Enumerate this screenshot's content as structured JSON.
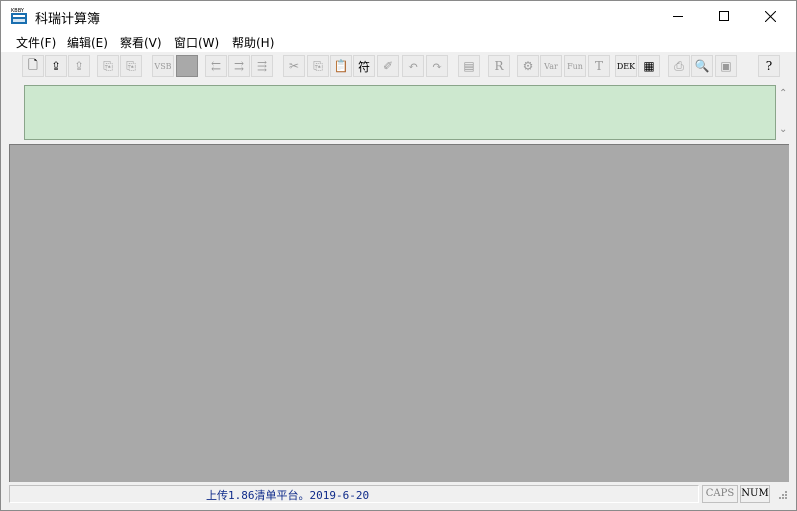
{
  "window": {
    "title": "科瑞计算簿",
    "icon_text": "KBBY"
  },
  "menu": [
    {
      "label": "文件(F)"
    },
    {
      "label": "编辑(E)"
    },
    {
      "label": "察看(V)"
    },
    {
      "label": "窗口(W)"
    },
    {
      "label": "帮助(H)"
    }
  ],
  "toolbar": {
    "buttons": [
      {
        "icon": "new-document-icon",
        "glyph": "🗋",
        "enabled": true
      },
      {
        "icon": "open-icon",
        "glyph": "⇪",
        "enabled": true
      },
      {
        "icon": "save-icon",
        "glyph": "⇪",
        "enabled": false
      },
      {
        "icon": "copy-page-icon",
        "glyph": "⎘",
        "enabled": false
      },
      {
        "icon": "paste-page-icon",
        "glyph": "⎘",
        "enabled": false
      },
      {
        "icon": "vsb-icon",
        "glyph": "VSB",
        "enabled": false
      },
      {
        "icon": "blank-icon",
        "glyph": "",
        "enabled": false
      },
      {
        "icon": "arrow-left-icon",
        "glyph": "⇇",
        "enabled": false
      },
      {
        "icon": "arrow-return-icon",
        "glyph": "⇉",
        "enabled": false
      },
      {
        "icon": "clear-icon",
        "glyph": "⇶",
        "enabled": false
      },
      {
        "icon": "cut-icon",
        "glyph": "✂",
        "enabled": false
      },
      {
        "icon": "copy-icon",
        "glyph": "⎘",
        "enabled": false
      },
      {
        "icon": "paste-icon",
        "glyph": "📋",
        "enabled": false
      },
      {
        "icon": "font-icon",
        "glyph": "符",
        "enabled": true
      },
      {
        "icon": "bookmark-icon",
        "glyph": "✐",
        "enabled": false
      },
      {
        "icon": "undo-icon",
        "glyph": "↶",
        "enabled": false
      },
      {
        "icon": "redo-icon",
        "glyph": "↷",
        "enabled": false
      },
      {
        "icon": "clipboard-icon",
        "glyph": "▤",
        "enabled": false
      },
      {
        "icon": "r-icon",
        "glyph": "R",
        "enabled": false
      },
      {
        "icon": "gear-icon",
        "glyph": "⚙",
        "enabled": false
      },
      {
        "icon": "var-icon",
        "glyph": "Var",
        "enabled": false
      },
      {
        "icon": "fun-icon",
        "glyph": "Fun",
        "enabled": false
      },
      {
        "icon": "text-icon",
        "glyph": "T",
        "enabled": false
      },
      {
        "icon": "dek-icon",
        "glyph": "DEK",
        "enabled": true
      },
      {
        "icon": "calculator-icon",
        "glyph": "▦",
        "enabled": true
      },
      {
        "icon": "print-icon",
        "glyph": "⎙",
        "enabled": false
      },
      {
        "icon": "print-preview-icon",
        "glyph": "🔍",
        "enabled": false
      },
      {
        "icon": "image-icon",
        "glyph": "▣",
        "enabled": false
      },
      {
        "icon": "help-icon",
        "glyph": "?",
        "enabled": true
      }
    ]
  },
  "formula": {
    "value": ""
  },
  "statusbar": {
    "main": "上传1.86清单平台。2019-6-20",
    "caps": "CAPS",
    "num": "NUM"
  }
}
